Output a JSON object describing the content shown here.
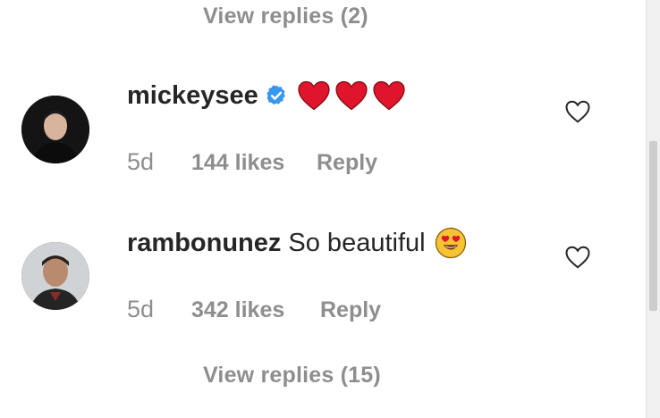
{
  "thread": {
    "top_view_replies": "View replies (2)",
    "bottom_view_replies": "View replies (15)"
  },
  "comments": [
    {
      "username": "mickeysee",
      "verified": true,
      "text": "",
      "emoji": "❤️❤️❤️",
      "age": "5d",
      "likes": "144 likes",
      "reply": "Reply"
    },
    {
      "username": "rambonunez",
      "verified": false,
      "text": "So beautiful",
      "emoji": "😍",
      "age": "5d",
      "likes": "342 likes",
      "reply": "Reply"
    }
  ],
  "icons": {
    "verified": "verified-badge-icon",
    "like": "heart-outline-icon",
    "red_heart": "red-heart-emoji",
    "heart_eyes": "heart-eyes-emoji"
  },
  "colors": {
    "secondary_text": "#8e8e8e",
    "primary_text": "#262626",
    "verified_blue": "#3897f0",
    "emoji_red": "#e0142a"
  }
}
